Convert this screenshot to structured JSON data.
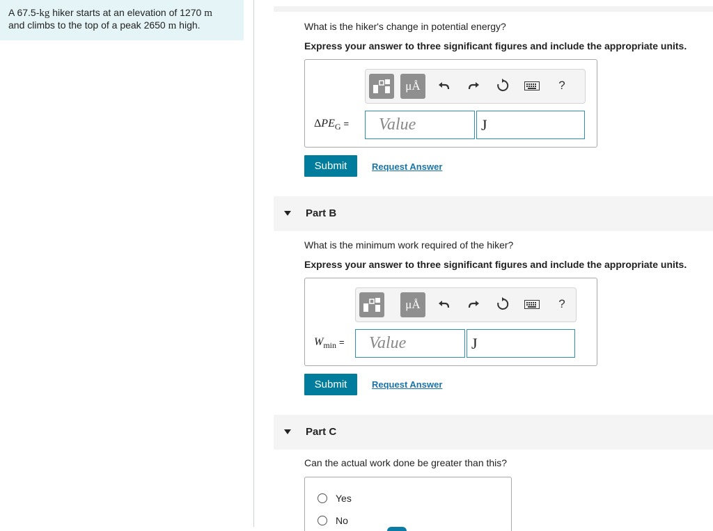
{
  "problem": {
    "line1_prefix": "A 67.5-",
    "line1_unit1": "kg",
    "line1_mid": " hiker starts at an elevation of 1270 ",
    "line1_unit2": "m",
    "line2_prefix": "and climbs to the top of a peak 2650 ",
    "line2_unit": "m",
    "line2_suffix": " high."
  },
  "part_a": {
    "question": "What is the hiker's change in potential energy?",
    "instruction": "Express your answer to three significant figures and include the appropriate units.",
    "var_delta": "Δ",
    "var_main": "PE",
    "var_sub": "G",
    "equals": "=",
    "value_placeholder": "Value",
    "unit_value": "J",
    "submit_label": "Submit",
    "request_label": "Request Answer"
  },
  "part_b": {
    "header": "Part B",
    "question": "What is the minimum work required of the hiker?",
    "instruction": "Express your answer to three significant figures and include the appropriate units.",
    "var_main": "W",
    "var_sub": "min",
    "equals": "=",
    "value_placeholder": "Value",
    "unit_value": "J",
    "submit_label": "Submit",
    "request_label": "Request Answer"
  },
  "part_c": {
    "header": "Part C",
    "question": "Can the actual work done be greater than this?",
    "options": [
      "Yes",
      "No"
    ]
  },
  "toolbar": {
    "units_label": "μÅ",
    "help_label": "?",
    "icons": [
      "templates-icon",
      "units-icon",
      "undo-icon",
      "redo-icon",
      "reset-icon",
      "keyboard-icon",
      "help-icon"
    ]
  },
  "colors": {
    "accent": "#007d9c",
    "link": "#1a74a8",
    "input_border": "#2f8fb0",
    "problem_bg": "#e5f4f6"
  }
}
